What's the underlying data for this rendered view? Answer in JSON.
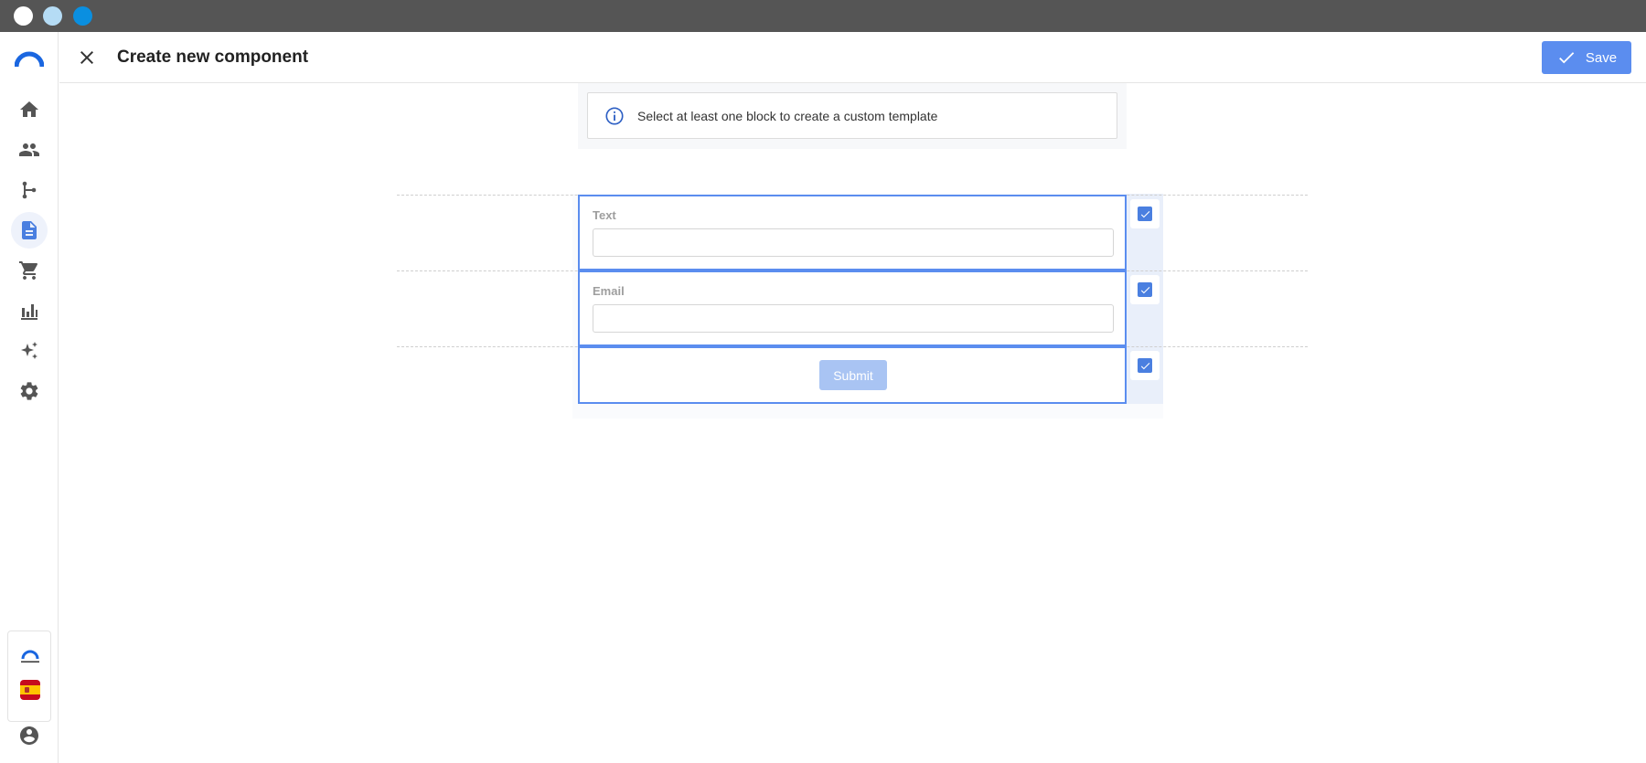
{
  "header": {
    "title": "Create new component",
    "save_label": "Save"
  },
  "notice": {
    "text": "Select at least one block to create a custom template"
  },
  "sidebar": {
    "items": [
      {
        "icon": "home-icon"
      },
      {
        "icon": "people-icon"
      },
      {
        "icon": "branch-icon"
      },
      {
        "icon": "document-icon",
        "active": true
      },
      {
        "icon": "cart-icon"
      },
      {
        "icon": "bar-chart-icon"
      },
      {
        "icon": "sparkle-icon"
      },
      {
        "icon": "gear-icon"
      }
    ],
    "language_flag": "spain-flag-icon",
    "account_icon": "account-circle-icon"
  },
  "blocks": [
    {
      "type": "field",
      "label": "Text",
      "checked": true
    },
    {
      "type": "field",
      "label": "Email",
      "checked": true
    },
    {
      "type": "button",
      "label": "Submit",
      "checked": true
    }
  ],
  "colors": {
    "accent": "#5b8def",
    "chrome": "#555555",
    "sidebar_active_bg": "#eef2fb"
  }
}
